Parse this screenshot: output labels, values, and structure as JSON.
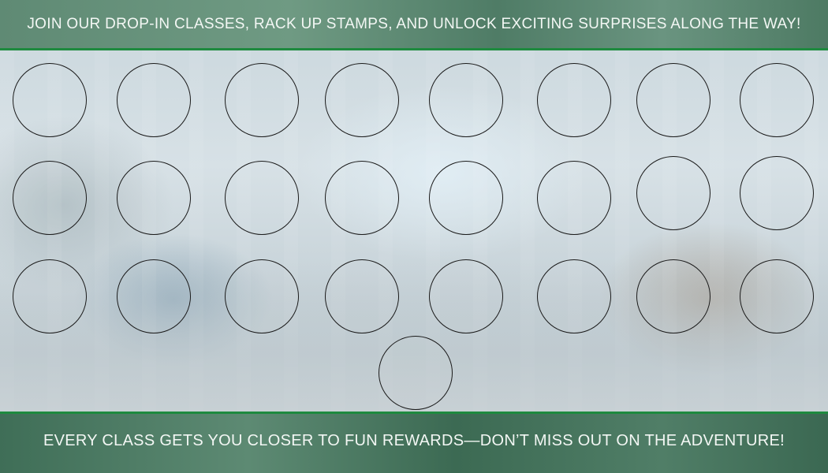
{
  "header": {
    "text": "JOIN OUR DROP-IN CLASSES, RACK UP STAMPS, AND UNLOCK EXCITING SURPRISES ALONG THE WAY!"
  },
  "footer": {
    "text": "EVERY CLASS GETS YOU CLOSER TO FUN REWARDS—DON’T MISS OUT ON THE ADVENTURE!"
  },
  "stamp_card": {
    "stamp_count": 25,
    "stamped": 0
  },
  "colors": {
    "accent_green": "#1e8a3f",
    "band_green": "#5f8a74",
    "text_light": "#f3f7f4",
    "stamp_outline": "#1a1a1a"
  }
}
